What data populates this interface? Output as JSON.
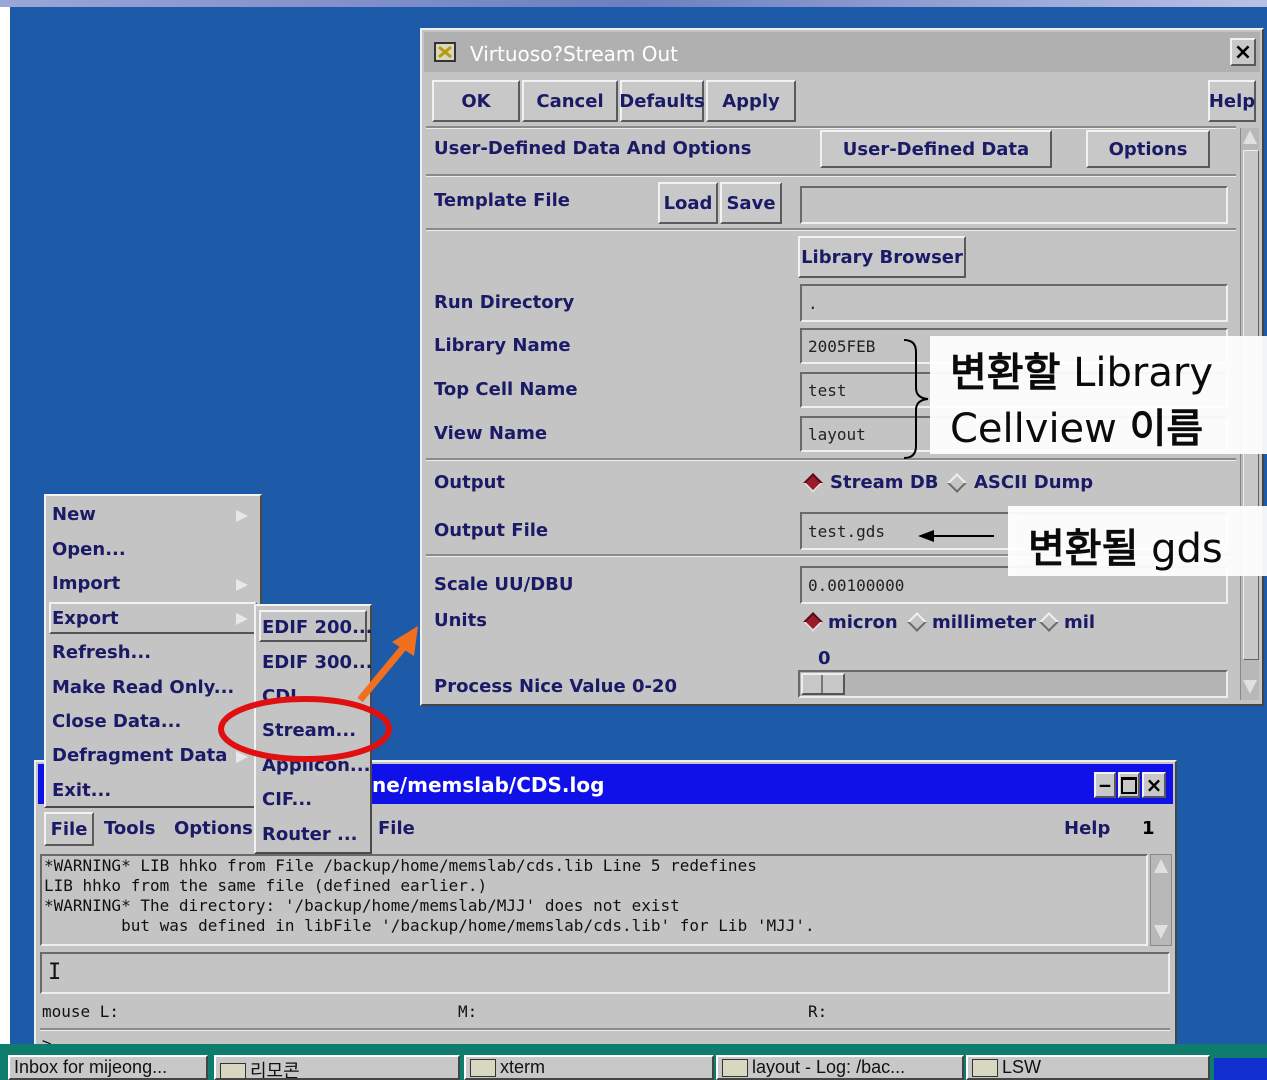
{
  "stream_dialog": {
    "title": "Virtuoso?Stream Out",
    "close_glyph": "×",
    "buttons": {
      "ok": "OK",
      "cancel": "Cancel",
      "defaults": "Defaults",
      "apply": "Apply",
      "help": "Help"
    },
    "user_defined_label": "User-Defined Data And Options",
    "user_defined_button": "User-Defined Data",
    "options_button": "Options",
    "template_file_label": "Template File",
    "load_button": "Load",
    "save_button": "Save",
    "template_file_value": "",
    "library_browser_button": "Library Browser",
    "run_directory_label": "Run Directory",
    "run_directory_value": ".",
    "library_name_label": "Library Name",
    "library_name_value": "2005FEB",
    "top_cell_label": "Top Cell Name",
    "top_cell_value": "test",
    "view_name_label": "View Name",
    "view_name_value": "layout",
    "output_label": "Output",
    "output_options": [
      "Stream DB",
      "ASCII Dump"
    ],
    "output_selected": "Stream DB",
    "output_file_label": "Output File",
    "output_file_value": "test.gds",
    "scale_label": "Scale UU/DBU",
    "scale_value": "0.00100000",
    "units_label": "Units",
    "units_options": [
      "micron",
      "millimeter",
      "mil"
    ],
    "units_selected": "micron",
    "nice_value_display": "0",
    "nice_label": "Process Nice Value 0-20",
    "nice_value": 0
  },
  "annotations": {
    "library_note_line1_ko": "변환할",
    "library_note_line1_en": "Library",
    "library_note_line2_en": "Cellview",
    "library_note_line2_ko": "이름",
    "gds_note_ko": "변환될",
    "gds_note_en": "gds",
    "arrow_color": "#f07020",
    "highlight_color": "#e01010"
  },
  "file_menu": {
    "items": [
      {
        "label": "New",
        "submenu": true
      },
      {
        "label": "Open...",
        "submenu": false
      },
      {
        "label": "Import",
        "submenu": true
      },
      {
        "label": "Export",
        "submenu": true
      },
      {
        "label": "Refresh...",
        "submenu": false
      },
      {
        "label": "Make Read Only...",
        "submenu": false
      },
      {
        "label": "Close Data...",
        "submenu": false
      },
      {
        "label": "Defragment Data",
        "submenu": true
      },
      {
        "label": "Exit...",
        "submenu": false
      }
    ],
    "export_submenu": [
      "EDIF 200...",
      "EDIF 300...",
      "CDL",
      "Stream...",
      "Applicon...",
      "CIF...",
      "Router ..."
    ]
  },
  "cds_window": {
    "title": "ne/memslab/CDS.log",
    "menubar": [
      "File",
      "Tools",
      "Options"
    ],
    "menubar_extra": "File",
    "help": "Help",
    "number": "1",
    "log_lines": [
      "*WARNING* LIB hhko from File /backup/home/memslab/cds.lib Line 5 redefines",
      "LIB hhko from the same file (defined earlier.)",
      "*WARNING* The directory: '/backup/home/memslab/MJJ' does not exist",
      "        but was defined in libFile '/backup/home/memslab/cds.lib' for Lib 'MJJ'."
    ],
    "input_cursor": "I",
    "mouse_l": "mouse L:",
    "mouse_m": "M:",
    "mouse_r": "R:",
    "prompt": ">"
  },
  "taskbar": {
    "items": [
      "Inbox for mijeong...",
      "리모콘",
      "xterm",
      "layout - Log: /bac...",
      "LSW"
    ]
  }
}
